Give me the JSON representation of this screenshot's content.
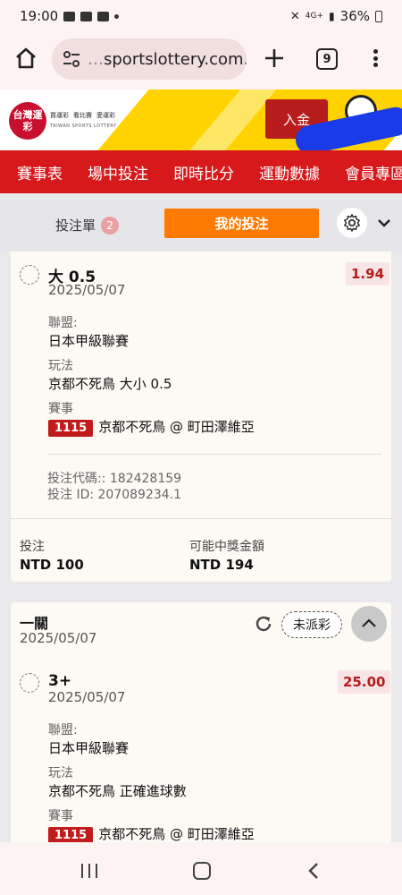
{
  "status_bar": {
    "time": "19:00",
    "battery": "36%",
    "network": "4G+"
  },
  "browser": {
    "url_prefix": "…",
    "url": "sportslottery.com.tw",
    "tab_count": "9"
  },
  "site": {
    "logo_text": "台灣運彩",
    "logo_links": [
      "買運彩",
      "看比賽",
      "愛運彩"
    ],
    "logo_sub": "TAIWAN SPORTS LOTTERY",
    "deposit_label": "入金"
  },
  "nav": {
    "items": [
      "賽事表",
      "場中投注",
      "即時比分",
      "運動數據",
      "會員專區"
    ]
  },
  "slip": {
    "betslip_label": "投注單",
    "betslip_count": "2",
    "my_bets_label": "我的投注"
  },
  "bet1": {
    "selection": "大 0.5",
    "date": "2025/05/07",
    "odds": "1.94",
    "league_label": "聯盟:",
    "league": "日本甲級聯賽",
    "market_label": "玩法",
    "market": "京都不死鳥 大小 0.5",
    "event_label": "賽事",
    "match_id": "1115",
    "match": "京都不死鳥 @ 町田澤維亞",
    "bet_code": "投注代碼:: 182428159",
    "bet_id": "投注 ID: 207089234.1",
    "stake_label": "投注",
    "stake": "NTD 100",
    "payout_label": "可能中獎金額",
    "payout": "NTD 194"
  },
  "bet2": {
    "type": "一關",
    "date": "2025/05/07",
    "status": "未派彩",
    "selection": "3+",
    "selection_date": "2025/05/07",
    "odds": "25.00",
    "league_label": "聯盟:",
    "league": "日本甲級聯賽",
    "market_label": "玩法",
    "market": "京都不死鳥 正確進球數",
    "event_label": "賽事",
    "match_id": "1115",
    "match": "京都不死鳥 @ 町田澤維亞"
  }
}
